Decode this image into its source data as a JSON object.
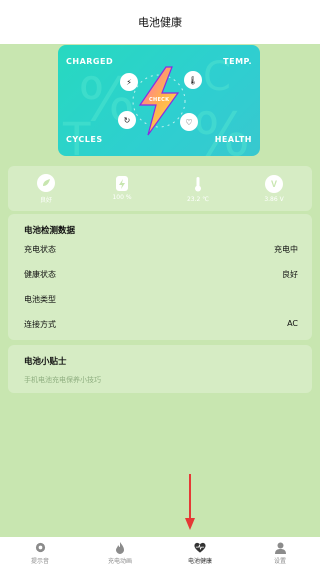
{
  "header": {
    "title": "电池健康"
  },
  "banner": {
    "corners": [
      "CHARGED",
      "TEMP.",
      "CYCLES",
      "HEALTH"
    ],
    "center_label": "CHECK"
  },
  "stats": [
    {
      "icon": "leaf-icon",
      "value": "良好"
    },
    {
      "icon": "battery-icon",
      "value": "100 %"
    },
    {
      "icon": "thermometer-icon",
      "value": "23.2 ℃"
    },
    {
      "icon": "voltage-icon",
      "value": "3.86 V"
    }
  ],
  "data": {
    "title": "电池检测数据",
    "rows": [
      {
        "label": "充电状态",
        "value": "充电中"
      },
      {
        "label": "健康状态",
        "value": "良好"
      },
      {
        "label": "电池类型",
        "value": ""
      },
      {
        "label": "连接方式",
        "value": "AC"
      }
    ]
  },
  "tips": {
    "title": "电池小贴士",
    "subtitle": "手机电池充电保养小技巧"
  },
  "tabs": [
    {
      "label": "提示音",
      "icon": "gear-icon",
      "active": false
    },
    {
      "label": "充电动画",
      "icon": "flame-icon",
      "active": false
    },
    {
      "label": "电池健康",
      "icon": "heart-icon",
      "active": true
    },
    {
      "label": "设置",
      "icon": "user-icon",
      "active": false
    }
  ],
  "colors": {
    "background": "#c8e6b0",
    "card": "#d6ecc4",
    "banner": "#2ecfd0",
    "arrow": "#e53935"
  }
}
